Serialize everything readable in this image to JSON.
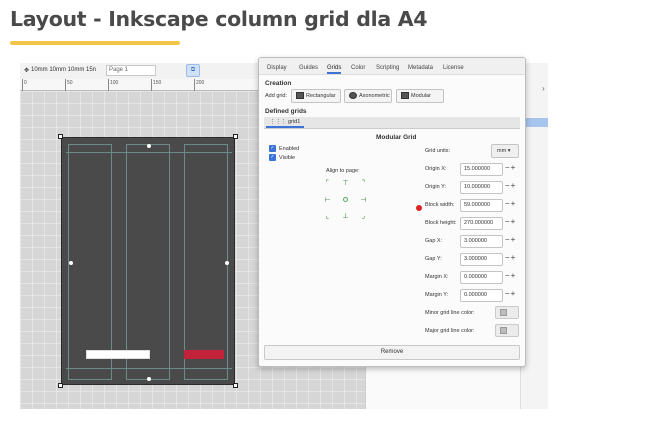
{
  "page": {
    "title": "Layout - Inkscape column grid dla A4",
    "accent_color": "#f5c54a"
  },
  "toolbar": {
    "snap_text": "10mm 10mm 10mm 15n",
    "page_field_value": "Page 1"
  },
  "ruler": {
    "ticks": [
      "0",
      "50",
      "100",
      "150",
      "200"
    ]
  },
  "dialog": {
    "tabs": [
      "Display",
      "Guides",
      "Grids",
      "Color",
      "Scripting",
      "Metadata",
      "License"
    ],
    "active_tab": "Grids",
    "creation_title": "Creation",
    "add_grid_label": "Add grid:",
    "add_buttons": {
      "rectangular": "Rectangular",
      "axonometric": "Axonometric",
      "modular": "Modular"
    },
    "defined_grids_title": "Defined grids",
    "grid_tab_label": "grid1",
    "modular_title": "Modular Grid",
    "enabled_label": "Enabled",
    "visible_label": "Visible",
    "align_label": "Align to page:",
    "grid_units_label": "Grid units:",
    "grid_units_value": "mm",
    "fields": {
      "origin_x": {
        "label": "Origin X:",
        "value": "15.000000"
      },
      "origin_y": {
        "label": "Origin Y:",
        "value": "10.000000"
      },
      "block_width": {
        "label": "Block width:",
        "value": "59.000000"
      },
      "block_height": {
        "label": "Block height:",
        "value": "270.000000"
      },
      "gap_x": {
        "label": "Gap X:",
        "value": "3.000000"
      },
      "gap_y": {
        "label": "Gap Y:",
        "value": "3.000000"
      },
      "margin_x": {
        "label": "Margin X:",
        "value": "0.000000"
      },
      "margin_y": {
        "label": "Margin Y:",
        "value": "0.000000"
      }
    },
    "minor_color_label": "Minor grid line color:",
    "major_color_label": "Major grid line color:",
    "remove_label": "Remove"
  }
}
